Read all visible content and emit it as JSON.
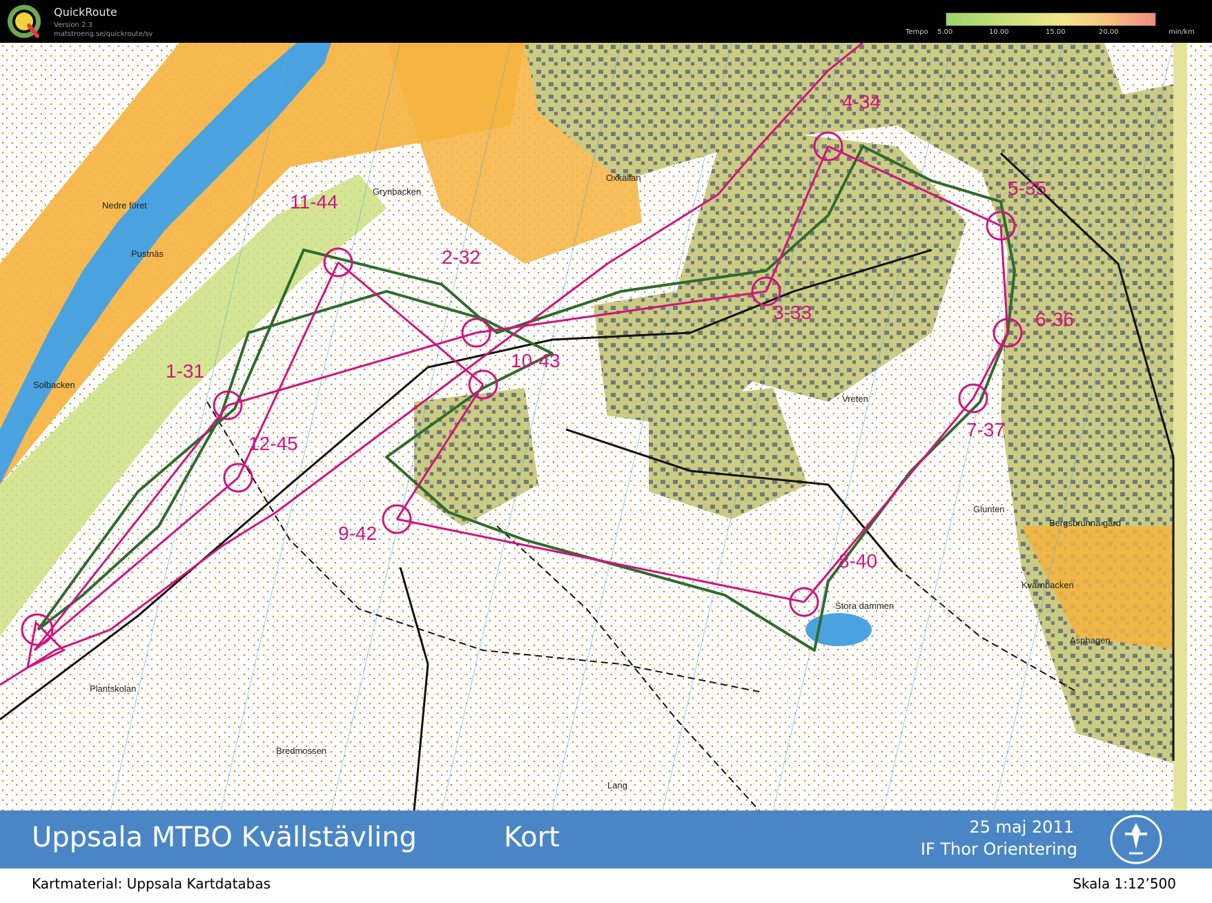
{
  "app": {
    "name": "QuickRoute",
    "version": "Version 2.3",
    "url": "matstroeng.se/quickroute/sv"
  },
  "tempo": {
    "label": "Tempo",
    "ticks": [
      "5.00",
      "10.00",
      "15.00",
      "20.00"
    ],
    "unit": "min/km"
  },
  "map": {
    "place_names": [
      "Nedre föret",
      "Pustnäs",
      "Solbacken",
      "Grynbacken",
      "Oxkällan",
      "Vreten",
      "Glunten",
      "Bergsbrunna gård",
      "Kvarnbacken",
      "Stora dammen",
      "Asphagen",
      "Plantskolan",
      "Bredmossen",
      "Lang"
    ],
    "controls": [
      {
        "label": "1-31"
      },
      {
        "label": "2-32"
      },
      {
        "label": "3-33"
      },
      {
        "label": "4-34"
      },
      {
        "label": "5-35"
      },
      {
        "label": "6-36"
      },
      {
        "label": "7-37"
      },
      {
        "label": "8-40"
      },
      {
        "label": "9-42"
      },
      {
        "label": "10-43"
      },
      {
        "label": "11-44"
      },
      {
        "label": "12-45"
      }
    ],
    "colors": {
      "course": "#d0147e",
      "route": "#2f6b2f",
      "water": "#4aa3df",
      "open": "#f6b33e",
      "urban": "#c9cc82"
    }
  },
  "banner": {
    "event_title": "Uppsala MTBO Kvällstävling",
    "course": "Kort",
    "date": "25 maj 2011",
    "organizer": "IF Thor Orientering"
  },
  "footer": {
    "map_source": "Kartmaterial: Uppsala Kartdatabas",
    "scale": "Skala 1:12’500"
  }
}
